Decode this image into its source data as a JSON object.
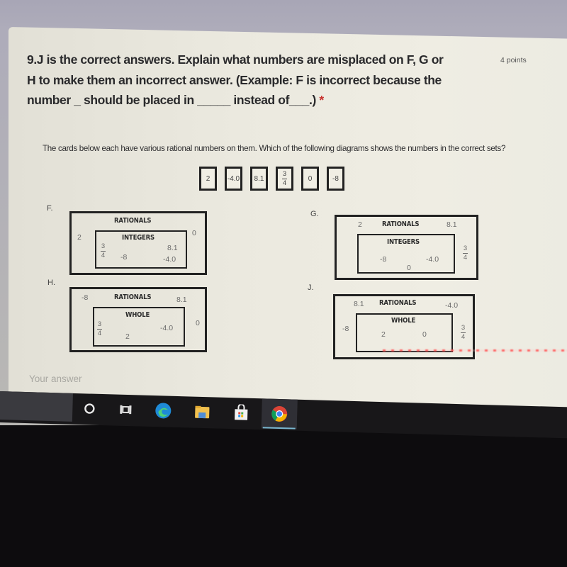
{
  "question": {
    "number": "9.",
    "text_line1": "J is the correct answers. Explain what numbers are misplaced on F, G or",
    "text_line2": "H to make them an incorrect answer. (Example: F is incorrect because the",
    "text_line3": "number _ should be placed in _____ instead of___.)",
    "required_marker": "*",
    "points": "4 points"
  },
  "prompt": {
    "text": "The cards below each have various rational numbers on them.  Which of the following diagrams shows the numbers in the correct sets?"
  },
  "cards": [
    {
      "value": "2"
    },
    {
      "value": "-4.0"
    },
    {
      "value": "8.1"
    },
    {
      "numerator": "3",
      "denominator": "4"
    },
    {
      "value": "0"
    },
    {
      "value": "-8"
    }
  ],
  "options": {
    "F": {
      "letter": "F.",
      "outer_label": "RATIONALS",
      "inner_label": "INTEGERS",
      "outer_numbers": [
        "2",
        "0"
      ],
      "inner_numbers": [
        "3/4",
        "-8",
        "8.1",
        "-4.0"
      ]
    },
    "G": {
      "letter": "G.",
      "outer_label": "RATIONALS",
      "inner_label": "INTEGERS",
      "outer_numbers": [
        "2",
        "8.1",
        "3/4"
      ],
      "inner_numbers": [
        "-8",
        "-4.0",
        "0"
      ]
    },
    "H": {
      "letter": "H.",
      "outer_label": "RATIONALS",
      "inner_label": "WHOLE",
      "outer_numbers": [
        "-8",
        "8.1",
        "0"
      ],
      "inner_numbers": [
        "3/4",
        "2",
        "-4.0"
      ]
    },
    "J": {
      "letter": "J.",
      "outer_label": "RATIONALS",
      "inner_label": "WHOLE",
      "outer_numbers": [
        "8.1",
        "-4.0",
        "-8",
        "3/4"
      ],
      "inner_numbers": [
        "2",
        "0"
      ]
    }
  },
  "answer": {
    "placeholder": "Your answer"
  },
  "taskbar": {
    "icons": [
      "cortana-icon",
      "task-view-icon",
      "edge-icon",
      "file-explorer-icon",
      "store-icon",
      "chrome-icon"
    ],
    "active": "chrome-icon"
  }
}
